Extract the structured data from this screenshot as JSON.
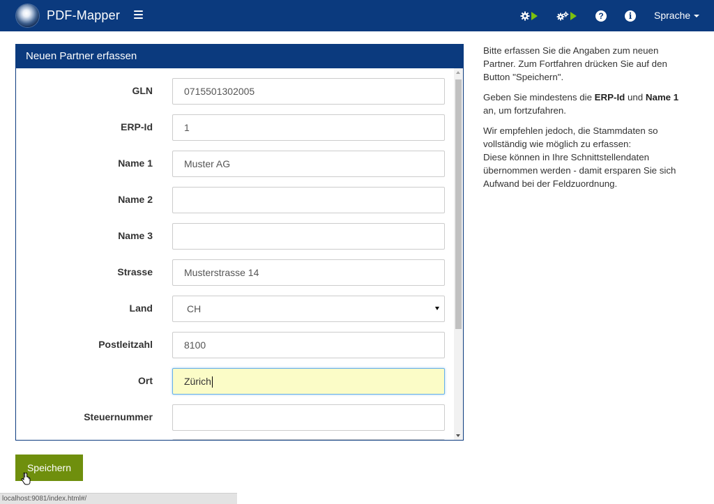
{
  "app": {
    "brand": "PDF-Mapper"
  },
  "navbar": {
    "language_label": "Sprache"
  },
  "panel": {
    "title": "Neuen Partner erfassen",
    "fields": [
      {
        "label": "GLN",
        "value": "0715501302005"
      },
      {
        "label": "ERP-Id",
        "value": "1"
      },
      {
        "label": "Name 1",
        "value": "Muster AG"
      },
      {
        "label": "Name 2",
        "value": ""
      },
      {
        "label": "Name 3",
        "value": ""
      },
      {
        "label": "Strasse",
        "value": "Musterstrasse 14"
      },
      {
        "label": "Land",
        "value": "CH"
      },
      {
        "label": "Postleitzahl",
        "value": "8100"
      },
      {
        "label": "Ort",
        "value": "Zürich"
      },
      {
        "label": "Steuernummer",
        "value": ""
      }
    ]
  },
  "info": {
    "p1": "Bitte erfassen Sie die Angaben zum neuen Partner. Zum Fortfahren drücken Sie auf den Button \"Speichern\".",
    "p2_pre": "Geben Sie mindestens die ",
    "p2_b1": "ERP-Id",
    "p2_mid": " und ",
    "p2_b2": "Name 1",
    "p2_post": " an, um fortzufahren.",
    "p3_line1": "Wir empfehlen jedoch, die Stammdaten so vollständig wie möglich zu erfassen:",
    "p3_line2": "Diese können in Ihre Schnittstellendaten übernommen werden - damit ersparen Sie sich Aufwand bei der Feldzuordnung."
  },
  "save_button": "Speichern",
  "statusbar": "localhost:9081/index.html#/",
  "colors": {
    "navbar": "#0b3a7e",
    "accent_green": "#7cc00e",
    "save_button": "#6f8f0d",
    "active_field": "#fbfcc7"
  },
  "icons": [
    "gear-play-icon",
    "gears-play-icon",
    "help-icon",
    "info-icon",
    "hamburger-icon",
    "caret-down-icon"
  ]
}
